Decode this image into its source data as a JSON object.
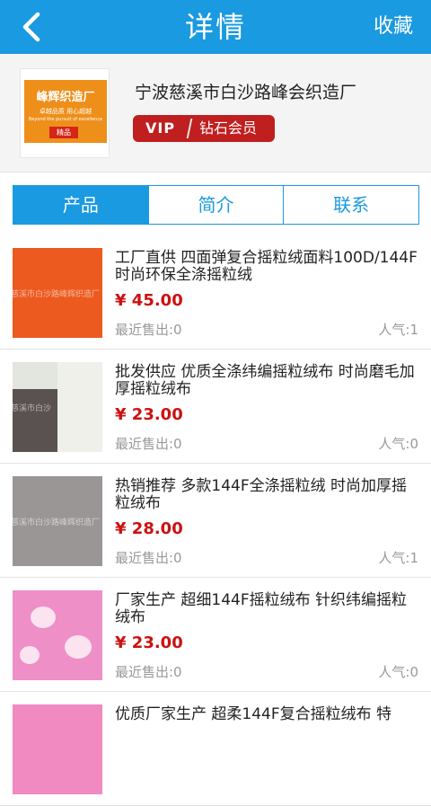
{
  "header": {
    "title": "详情",
    "favorite_label": "收藏"
  },
  "shop": {
    "logo": {
      "name": "峰辉织造厂",
      "slogan": "卓越品质  用心超越",
      "slogan_en": "Beyond the pursuit of excellence",
      "badge": "精品"
    },
    "name": "宁波慈溪市白沙路峰会织造厂",
    "vip_left": "VIP",
    "vip_right": "钻石会员"
  },
  "tabs": [
    {
      "label": "产品",
      "active": true
    },
    {
      "label": "简介",
      "active": false
    },
    {
      "label": "联系",
      "active": false
    }
  ],
  "products": [
    {
      "title": "工厂直供 四面弹复合摇粒绒面料100D/144F 时尚环保全涤摇粒绒",
      "price": "¥ 45.00",
      "sold": "最近售出:0",
      "popularity": "人气:1",
      "color": "#ec5a1f",
      "watermark": "慈溪市白沙路峰辉织造厂"
    },
    {
      "title": "批发供应 优质全涤纬编摇粒绒布 时尚磨毛加厚摇粒绒布",
      "price": "¥ 23.00",
      "sold": "最近售出:0",
      "popularity": "人气:0",
      "color": "#5a5250",
      "watermark": "慈溪市白沙"
    },
    {
      "title": "热销推荐 多款144F全涤摇粒绒 时尚加厚摇粒绒布",
      "price": "¥ 28.00",
      "sold": "最近售出:0",
      "popularity": "人气:1",
      "color": "#9a9696",
      "watermark": "慈溪市白沙路峰辉织造厂"
    },
    {
      "title": "厂家生产 超细144F摇粒绒布 针织纬编摇粒绒布",
      "price": "¥ 23.00",
      "sold": "最近售出:0",
      "popularity": "人气:0",
      "color": "#ee8fc8",
      "watermark": ""
    },
    {
      "title": "优质厂家生产 超柔144F复合摇粒绒布 特",
      "price": "",
      "sold": "",
      "popularity": "",
      "color": "#f08ac0",
      "watermark": ""
    }
  ]
}
